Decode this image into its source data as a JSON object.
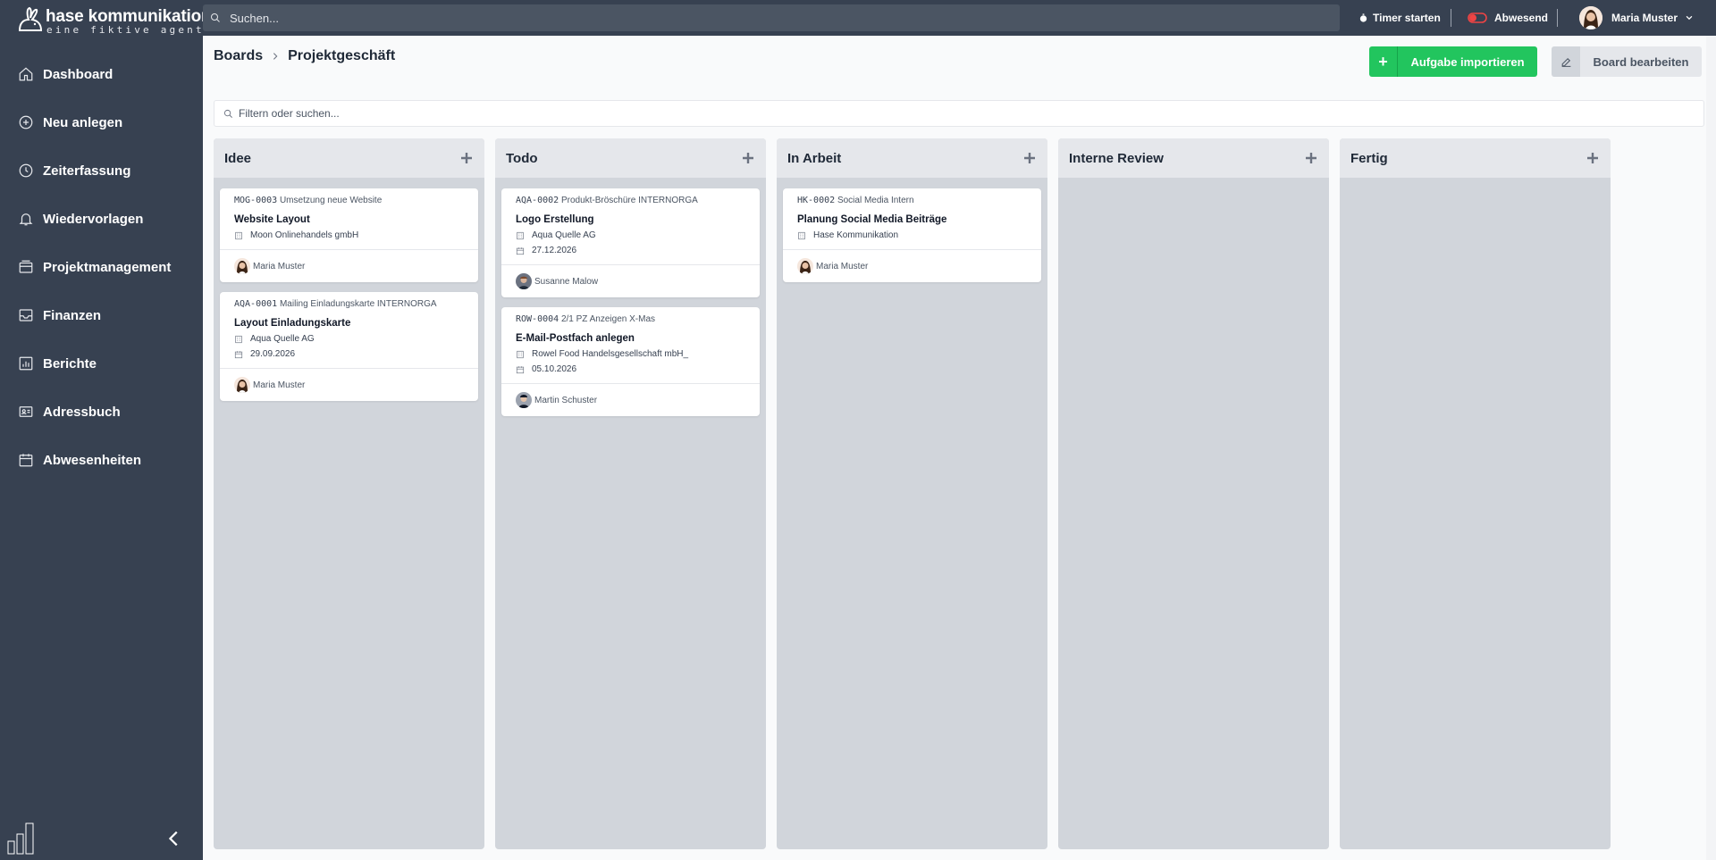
{
  "brand": {
    "name": "hase kommunikation",
    "tagline": "eine fiktive agentur"
  },
  "sidebar": {
    "items": [
      {
        "label": "Dashboard",
        "icon": "home-icon"
      },
      {
        "label": "Neu anlegen",
        "icon": "plus-circle-icon"
      },
      {
        "label": "Zeiterfassung",
        "icon": "clock-icon"
      },
      {
        "label": "Wiedervorlagen",
        "icon": "bell-icon"
      },
      {
        "label": "Projektmanagement",
        "icon": "archive-icon"
      },
      {
        "label": "Finanzen",
        "icon": "inbox-icon"
      },
      {
        "label": "Berichte",
        "icon": "chart-icon"
      },
      {
        "label": "Adressbuch",
        "icon": "contact-card-icon"
      },
      {
        "label": "Abwesenheiten",
        "icon": "calendar-icon"
      }
    ]
  },
  "topbar": {
    "search_placeholder": "Suchen...",
    "timer_label": "Timer starten",
    "status_label": "Abwesend",
    "user_name": "Maria Muster"
  },
  "breadcrumb": {
    "root": "Boards",
    "current": "Projektgeschäft"
  },
  "actions": {
    "import_label": "Aufgabe importieren",
    "edit_label": "Board bearbeiten"
  },
  "filter": {
    "placeholder": "Filtern oder suchen..."
  },
  "columns": [
    {
      "title": "Idee",
      "cards": [
        {
          "code": "MOG-0003",
          "project": "Umsetzung neue Website",
          "title": "Website Layout",
          "company": "Moon Onlinehandels gmbH",
          "date": "",
          "assignee": "Maria Muster"
        },
        {
          "code": "AQA-0001",
          "project": "Mailing Einladungskarte INTERNORGA",
          "title": "Layout Einladungskarte",
          "company": "Aqua Quelle AG",
          "date": "29.09.2026",
          "assignee": "Maria Muster"
        }
      ]
    },
    {
      "title": "Todo",
      "cards": [
        {
          "code": "AQA-0002",
          "project": "Produkt-Bröschüre INTERNORGA",
          "title": "Logo Erstellung",
          "company": "Aqua Quelle AG",
          "date": "27.12.2026",
          "assignee": "Susanne Malow"
        },
        {
          "code": "ROW-0004",
          "project": "2/1 PZ Anzeigen X-Mas",
          "title": "E-Mail-Postfach anlegen",
          "company": "Rowel Food Handelsgesellschaft mbH_",
          "date": "05.10.2026",
          "assignee": "Martin Schuster"
        }
      ]
    },
    {
      "title": "In Arbeit",
      "cards": [
        {
          "code": "HK-0002",
          "project": "Social Media Intern",
          "title": "Planung Social Media Beiträge",
          "company": "Hase Kommunikation",
          "date": "",
          "assignee": "Maria Muster"
        }
      ]
    },
    {
      "title": "Interne Review",
      "cards": []
    },
    {
      "title": "Fertig",
      "cards": []
    }
  ],
  "colors": {
    "sidebar_bg": "#374151",
    "accent_green": "#22c55e",
    "status_red": "#ef4444"
  }
}
